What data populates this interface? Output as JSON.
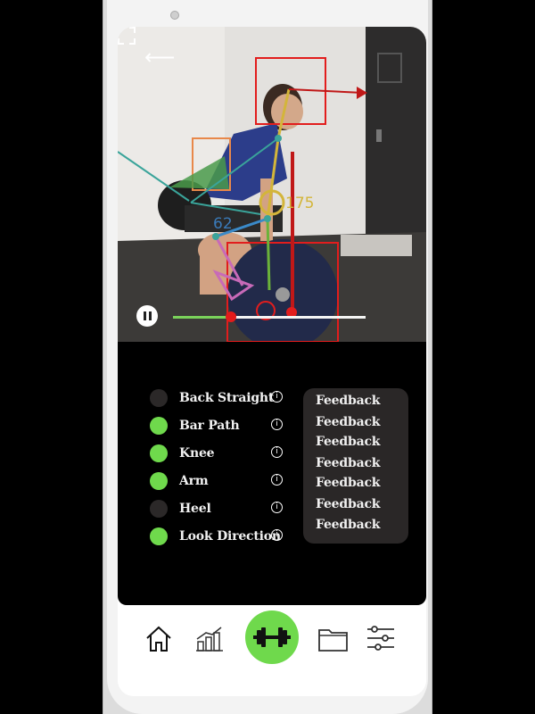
{
  "video": {
    "angle_hip": "175",
    "angle_knee": "62",
    "progress": 0.3
  },
  "metrics": [
    {
      "label": "Back Straight",
      "active": false
    },
    {
      "label": "Bar Path",
      "active": true
    },
    {
      "label": "Knee",
      "active": true
    },
    {
      "label": "Arm",
      "active": true
    },
    {
      "label": "Heel",
      "active": false
    },
    {
      "label": "Look Direction",
      "active": true
    }
  ],
  "info_glyph": "i",
  "feedback": [
    "Feedback",
    "Feedback",
    "Feedback",
    "Feedback",
    "Feedback",
    "Feedback",
    "Feedback"
  ],
  "colors": {
    "active_dot": "#6fd94c",
    "inactive_dot": "#2b2828",
    "accent_green": "#6fd94c",
    "progress_fill": "#7ad25a",
    "progress_thumb": "#e31b1b"
  },
  "nav": {
    "items": [
      "home-icon",
      "chart-icon",
      "dumbbell-icon",
      "folder-icon",
      "sliders-icon"
    ]
  }
}
